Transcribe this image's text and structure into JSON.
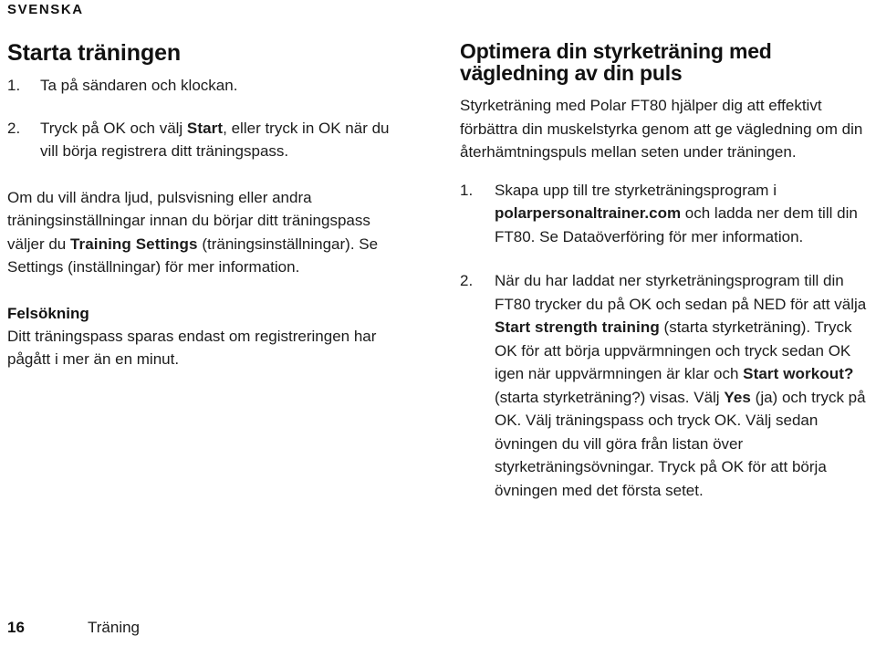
{
  "running_head": "SVENSKA",
  "left_column": {
    "heading": "Starta träningen",
    "steps": [
      {
        "num": "1.",
        "parts": [
          {
            "type": "text",
            "value": "Ta på sändaren och klockan."
          }
        ]
      },
      {
        "num": "2.",
        "parts": [
          {
            "type": "text",
            "value": "Tryck på OK och välj "
          },
          {
            "type": "ui",
            "value": "Start"
          },
          {
            "type": "text",
            "value": ", eller tryck in OK när du vill börja registrera ditt träningspass."
          }
        ]
      }
    ],
    "paragraph": [
      {
        "type": "text",
        "value": "Om du vill ändra ljud, pulsvisning eller andra träningsinställningar innan du börjar ditt träningspass väljer du "
      },
      {
        "type": "ui",
        "value": "Training Settings"
      },
      {
        "type": "text",
        "value": " (träningsinställningar). Se Settings (inställningar) för mer information."
      }
    ],
    "subheading": "Felsökning",
    "subparagraph": [
      {
        "type": "text",
        "value": "Ditt träningspass sparas endast om registreringen har pågått i mer än en minut."
      }
    ]
  },
  "right_column": {
    "heading": "Optimera din styrketräning med vägledning av din puls",
    "intro": [
      {
        "type": "text",
        "value": "Styrketräning med Polar FT80 hjälper dig att effektivt förbättra din muskelstyrka genom att ge vägledning om din återhämtningspuls mellan seten under träningen."
      }
    ],
    "steps": [
      {
        "num": "1.",
        "parts": [
          {
            "type": "text",
            "value": "Skapa upp till tre styrketräningsprogram i "
          },
          {
            "type": "strong",
            "value": "polarpersonaltrainer.com"
          },
          {
            "type": "text",
            "value": " och ladda ner dem till din FT80. Se Dataöverföring för mer information."
          }
        ]
      },
      {
        "num": "2.",
        "parts": [
          {
            "type": "text",
            "value": "När du har laddat ner styrketräningsprogram till din FT80 trycker du på OK och sedan på NED för att välja "
          },
          {
            "type": "ui",
            "value": "Start strength training"
          },
          {
            "type": "text",
            "value": " (starta styrketräning). Tryck OK för att börja uppvärmningen och tryck sedan OK igen när uppvärmningen är klar och "
          },
          {
            "type": "ui",
            "value": "Start workout?"
          },
          {
            "type": "text",
            "value": " (starta styrketräning?) visas. Välj "
          },
          {
            "type": "ui",
            "value": "Yes"
          },
          {
            "type": "text",
            "value": " (ja) och tryck på OK. Välj träningspass och tryck OK. Välj sedan övningen du vill göra från listan över styrketräningsövningar. Tryck på OK för att börja övningen med det första setet."
          }
        ]
      }
    ]
  },
  "footer": {
    "page_number": "16",
    "chapter": "Träning"
  },
  "colors": {
    "background": "#ffffff",
    "text": "#1c1c1c",
    "heading": "#111111"
  }
}
